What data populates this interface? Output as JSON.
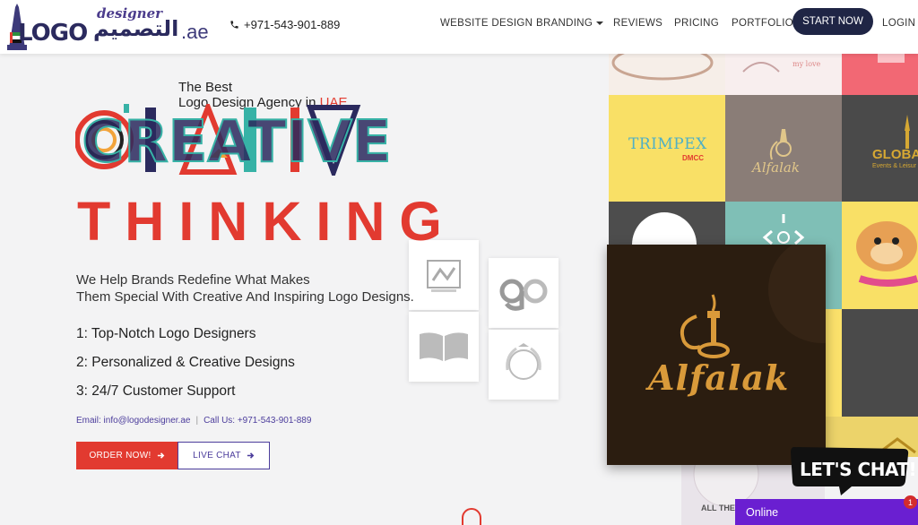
{
  "header": {
    "logo_word": "LOGO",
    "logo_script": "designer",
    "logo_arabic": "التصميم",
    "logo_ae": ".ae",
    "phone": "+971-543-901-889",
    "nav": [
      {
        "label": "WEBSITE DESIGN"
      },
      {
        "label": "BRANDING",
        "has_dropdown": true
      },
      {
        "label": "REVIEWS"
      },
      {
        "label": "PRICING"
      },
      {
        "label": "PORTFOLIO"
      }
    ],
    "start_button": "START NOW",
    "login": "LOGIN"
  },
  "hero": {
    "line1": "The Best",
    "line2": "Logo Design Agency in ",
    "line2_highlight": "UAE",
    "creative": "CREATIVE",
    "thinking": "THINKING",
    "tagline_1": "We Help Brands Redefine What Makes",
    "tagline_2": "Them Special With Creative And Inspiring Logo Designs.",
    "points": [
      "1: Top-Notch Logo Designers",
      "2: Personalized & Creative Designs",
      "3: 24/7 Customer Support"
    ],
    "email_text": "Email: info@logodesigner.ae",
    "call_text": "Call Us: +971-543-901-889",
    "order_button": "ORDER NOW!",
    "live_chat_button": "LIVE CHAT"
  },
  "portfolio": {
    "trimpex": "TRIMPEX",
    "dmcc": "DMCC",
    "alfalak": "Alfalak",
    "globa": "GLOBA",
    "globa_sub": "Events & Leisur",
    "feature": "Alfalak",
    "bottom_text": "ALL THE AI"
  },
  "chat": {
    "badge": "LET'S CHAT!",
    "status": "Online",
    "notifications": "1"
  },
  "colors": {
    "accent_red": "#e23a30",
    "accent_purple": "#4c3d9c",
    "navy": "#1f2545",
    "chat_purple": "#6a1fd1"
  }
}
